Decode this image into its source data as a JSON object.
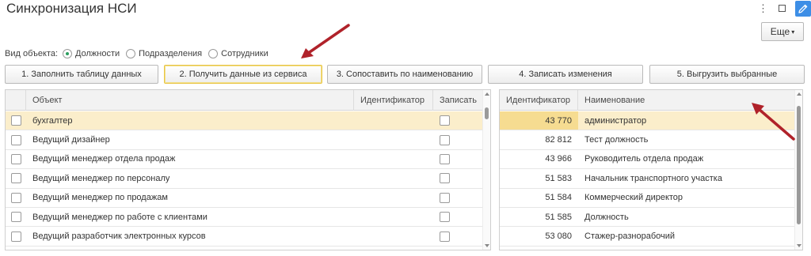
{
  "title": "Синхронизация НСИ",
  "header": {
    "more_label": "Еще",
    "more_caret": "▾",
    "menu_glyph": "⋮"
  },
  "object_kind": {
    "label": "Вид объекта:",
    "options": [
      {
        "label": "Должности",
        "checked": true
      },
      {
        "label": "Подразделения",
        "checked": false
      },
      {
        "label": "Сотрудники",
        "checked": false
      }
    ]
  },
  "toolbar": {
    "buttons": [
      {
        "label": "1. Заполнить таблицу данных"
      },
      {
        "label": "2. Получить данные из сервиса",
        "active": true
      },
      {
        "label": "3. Сопоставить по наименованию"
      },
      {
        "label": "4. Записать изменения"
      },
      {
        "label": "5. Выгрузить выбранные"
      }
    ]
  },
  "left_table": {
    "columns": [
      "Объект",
      "Идентификатор",
      "Записать"
    ],
    "rows": [
      {
        "object": "бухгалтер",
        "identifier": "",
        "selected": true
      },
      {
        "object": "Ведущий дизайнер",
        "identifier": ""
      },
      {
        "object": "Ведущий менеджер отдела продаж",
        "identifier": ""
      },
      {
        "object": "Ведущий менеджер по персоналу",
        "identifier": ""
      },
      {
        "object": "Ведущий менеджер по продажам",
        "identifier": ""
      },
      {
        "object": "Ведущий менеджер по работе с клиентами",
        "identifier": ""
      },
      {
        "object": "Ведущий разработчик электронных курсов",
        "identifier": ""
      }
    ]
  },
  "right_table": {
    "columns": [
      "Идентификатор",
      "Наименование"
    ],
    "rows": [
      {
        "id": "43 770",
        "name": "администратор",
        "selected": true
      },
      {
        "id": "82 812",
        "name": "Тест должность"
      },
      {
        "id": "43 966",
        "name": "Руководитель отдела продаж"
      },
      {
        "id": "51 583",
        "name": "Начальник транспортного участка"
      },
      {
        "id": "51 584",
        "name": "Коммерческий директор"
      },
      {
        "id": "51 585",
        "name": "Должность"
      },
      {
        "id": "53 080",
        "name": "Стажер-разнорабочий"
      }
    ]
  },
  "colors": {
    "selected_row": "#fbeecb",
    "selected_id_cell": "#f6dc91",
    "active_button_border": "#e8c546",
    "radio_accent": "#2a9d5e",
    "edit_button": "#3d8ee6",
    "annotation_arrow": "#b0222a"
  }
}
